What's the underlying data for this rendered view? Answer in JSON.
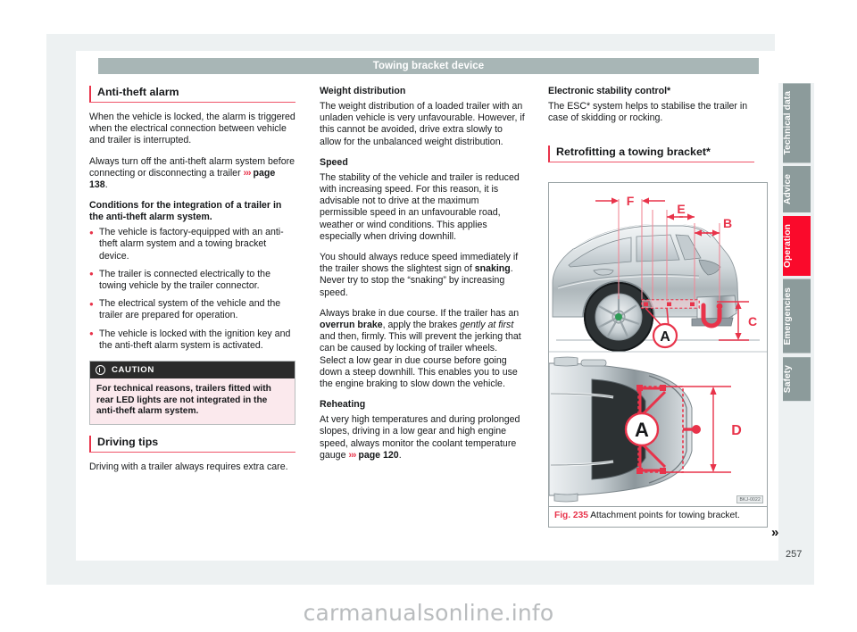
{
  "header": {
    "title": "Towing bracket device"
  },
  "column1": {
    "section_title": "Anti-theft alarm",
    "p1": "When the vehicle is locked, the alarm is triggered when the electrical connection between vehicle and trailer is interrupted.",
    "p2_a": "Always turn off the anti-theft alarm system before connecting or disconnecting a trailer ",
    "p2_ref_chev": "›››",
    "p2_ref": " page 138",
    "p2_end": ".",
    "sub1": "Conditions for the integration of a trailer in the anti-theft alarm system.",
    "bullets": [
      "The vehicle is factory-equipped with an anti-theft alarm system and a towing bracket device.",
      "The trailer is connected electrically to the towing vehicle by the trailer connector.",
      "The electrical system of the vehicle and the trailer are prepared for operation.",
      "The vehicle is locked with the ignition key and the anti-theft alarm system is activated."
    ],
    "caution_label": "CAUTION",
    "caution_text": "For technical reasons, trailers fitted with rear LED lights are not integrated in the anti-theft alarm system.",
    "section_title2": "Driving tips",
    "p3": "Driving with a trailer always requires extra care."
  },
  "column2": {
    "sub1": "Weight distribution",
    "p1": "The weight distribution of a loaded trailer with an unladen vehicle is very unfavourable. However, if this cannot be avoided, drive extra slowly to allow for the unbalanced weight distribution.",
    "sub2": "Speed",
    "p2": "The stability of the vehicle and trailer is reduced with increasing speed. For this reason, it is advisable not to drive at the maximum permissible speed in an unfavourable road, weather or wind conditions. This applies especially when driving downhill.",
    "p3_a": "You should always reduce speed immediately if the trailer shows the slightest sign of ",
    "p3_b": "snaking",
    "p3_c": ". Never try to stop the “snaking” by increasing speed.",
    "p4_a": "Always brake in due course. If the trailer has an ",
    "p4_b": "overrun brake",
    "p4_c": ", apply the brakes ",
    "p4_d": "gently at first",
    "p4_e": " and then, firmly. This will prevent the jerking that can be caused by locking of trailer wheels. Select a low gear in due course before going down a steep downhill. This enables you to use the engine braking to slow down the vehicle.",
    "sub3": "Reheating",
    "p5_a": "At very high temperatures and during prolonged slopes, driving in a low gear and high engine speed, always monitor the coolant temperature gauge ",
    "p5_chev": "›››",
    "p5_ref": " page 120",
    "p5_end": "."
  },
  "column3": {
    "sub1": "Electronic stability control*",
    "p1": "The ESC* system helps to stabilise the trailer in case of skidding or rocking.",
    "section_title": "Retrofitting a towing bracket*",
    "figure": {
      "number": "Fig. 235",
      "caption": "Attachment points for towing bracket.",
      "image_code": "BKJ-0022",
      "labels_top": [
        "F",
        "E",
        "B",
        "C",
        "A"
      ],
      "labels_bottom": [
        "A",
        "D"
      ]
    }
  },
  "continuation_arrow": "»",
  "page_number": "257",
  "side_tabs": [
    {
      "label": "Technical data",
      "active": false
    },
    {
      "label": "Advice",
      "active": false
    },
    {
      "label": "Operation",
      "active": true
    },
    {
      "label": "Emergencies",
      "active": false
    },
    {
      "label": "Safety",
      "active": false
    }
  ],
  "watermark": "carmanualsonline.info",
  "colors": {
    "accent_red": "#e8334a",
    "tab_active": "#fa0a2b",
    "tab_inactive": "#8c9b9b",
    "titlebar": "#a8b6b6",
    "caution_bg": "#fbe9ed"
  }
}
